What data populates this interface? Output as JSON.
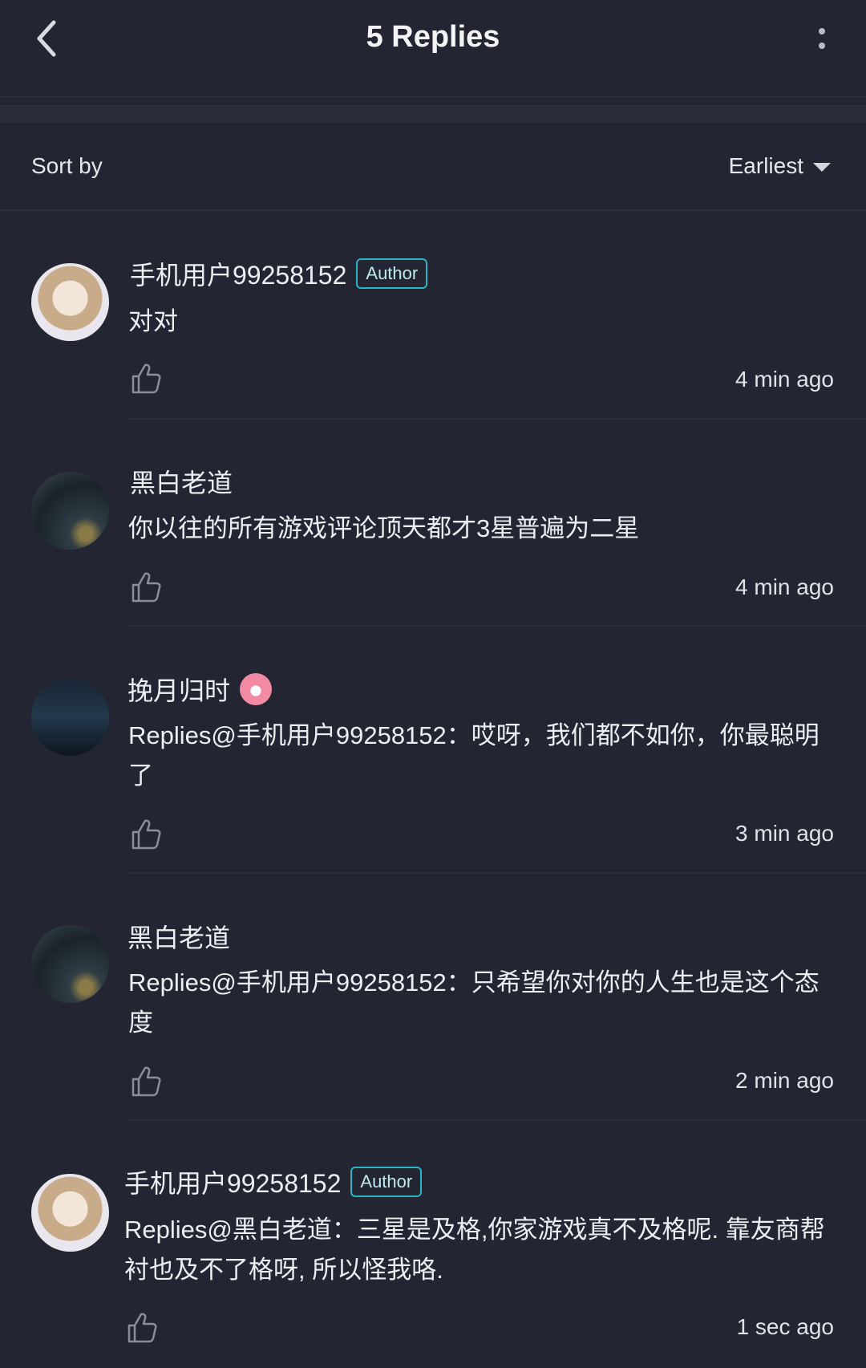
{
  "header": {
    "title": "5 Replies",
    "back_icon": "chevron-left-icon",
    "more_icon": "more-vertical-icon"
  },
  "sort": {
    "label": "Sort by",
    "selected": "Earliest"
  },
  "colors": {
    "background": "#232632",
    "author_badge_border": "#2bb4c3"
  },
  "replies": [
    {
      "username": "手机用户99258152",
      "badge": "Author",
      "text": "对对",
      "time": "4 min ago",
      "avatar": "anime-girl-avatar"
    },
    {
      "username": "黑白老道",
      "badge": "",
      "text": "你以往的所有游戏评论顶天都才3星普遍为二星",
      "time": "4 min ago",
      "avatar": "night-sky-avatar"
    },
    {
      "username": "挽月归时",
      "badge_icon": "fire-icon",
      "text": "Replies@手机用户99258152：哎呀，我们都不如你，你最聪明了",
      "time": "3 min ago",
      "avatar": "city-night-avatar"
    },
    {
      "username": "黑白老道",
      "badge": "",
      "text": "Replies@手机用户99258152：只希望你对你的人生也是这个态度",
      "time": "2 min ago",
      "avatar": "night-sky-avatar"
    },
    {
      "username": "手机用户99258152",
      "badge": "Author",
      "text": "Replies@黑白老道：三星是及格,你家游戏真不及格呢. 靠友商帮衬也及不了格呀, 所以怪我咯.",
      "time": "1 sec ago",
      "avatar": "anime-girl-avatar"
    }
  ]
}
